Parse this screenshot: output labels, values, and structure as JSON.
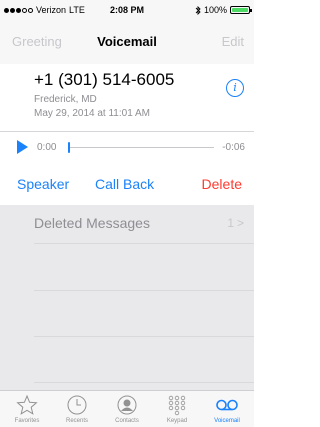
{
  "status_bar": {
    "carrier": "Verizon",
    "network": "LTE",
    "time": "2:08 PM",
    "bluetooth_icon": "bluetooth-icon",
    "battery_percent_label": "100%",
    "battery_level": 1.0
  },
  "nav": {
    "left_label": "Greeting",
    "title": "Voicemail",
    "right_label": "Edit"
  },
  "voicemail": {
    "number": "+1 (301) 514-6005",
    "location": "Frederick, MD",
    "date": "May 29, 2014 at 11:01 AM",
    "info_icon": "i"
  },
  "player": {
    "elapsed": "0:00",
    "remaining": "-0:06",
    "progress": 0.0
  },
  "actions": {
    "speaker": "Speaker",
    "call_back": "Call Back",
    "delete": "Delete"
  },
  "deleted": {
    "label": "Deleted Messages",
    "count": "1",
    "chevron": ">"
  },
  "tabs": [
    {
      "label": "Favorites",
      "icon": "star-icon"
    },
    {
      "label": "Recents",
      "icon": "clock-icon"
    },
    {
      "label": "Contacts",
      "icon": "person-icon"
    },
    {
      "label": "Keypad",
      "icon": "keypad-icon"
    },
    {
      "label": "Voicemail",
      "icon": "voicemail-icon"
    }
  ],
  "colors": {
    "accent": "#1a82fb",
    "destructive": "#ff3b30",
    "battery": "#4cd964"
  }
}
